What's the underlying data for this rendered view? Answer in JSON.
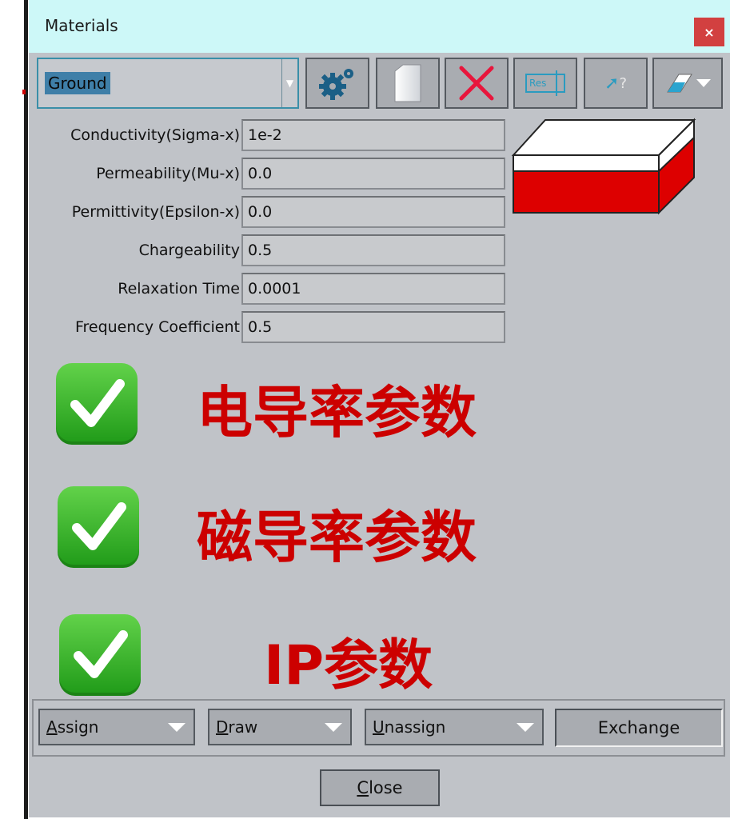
{
  "window": {
    "title": "Materials",
    "close_glyph": "×"
  },
  "toolbar": {
    "material_value": "Ground",
    "buttons": [
      {
        "icon": "gear-icon",
        "label": ""
      },
      {
        "icon": "new-document-icon",
        "label": ""
      },
      {
        "icon": "delete-x-icon",
        "label": ""
      },
      {
        "icon": "resistivity-icon",
        "label": "Res"
      },
      {
        "icon": "pointer-help-icon",
        "label": "?"
      },
      {
        "icon": "eraser-dropdown-icon",
        "label": ""
      }
    ]
  },
  "properties": [
    {
      "label": "Conductivity(Sigma-x)",
      "value": "1e-2"
    },
    {
      "label": "Permeability(Mu-x)",
      "value": "0.0"
    },
    {
      "label": "Permittivity(Epsilon-x)",
      "value": "0.0"
    },
    {
      "label": "Chargeability",
      "value": "0.5"
    },
    {
      "label": "Relaxation Time",
      "value": "0.0001"
    },
    {
      "label": "Frequency Coefficient",
      "value": "0.5"
    }
  ],
  "annotations": [
    {
      "text": "电导率参数"
    },
    {
      "text": "磁导率参数"
    },
    {
      "text": "IP参数"
    }
  ],
  "actions": {
    "assign": {
      "first": "A",
      "rest": "ssign"
    },
    "draw": {
      "first": "D",
      "rest": "raw"
    },
    "unassign": {
      "first": "U",
      "rest": "nassign"
    },
    "exchange": "Exchange"
  },
  "footer": {
    "close_first": "C",
    "close_rest": "lose"
  },
  "colors": {
    "accent_red": "#cc0000",
    "check_green": "#2fb028",
    "titlebar": "#cdf8f8",
    "window_bg": "#c0c3c8"
  }
}
